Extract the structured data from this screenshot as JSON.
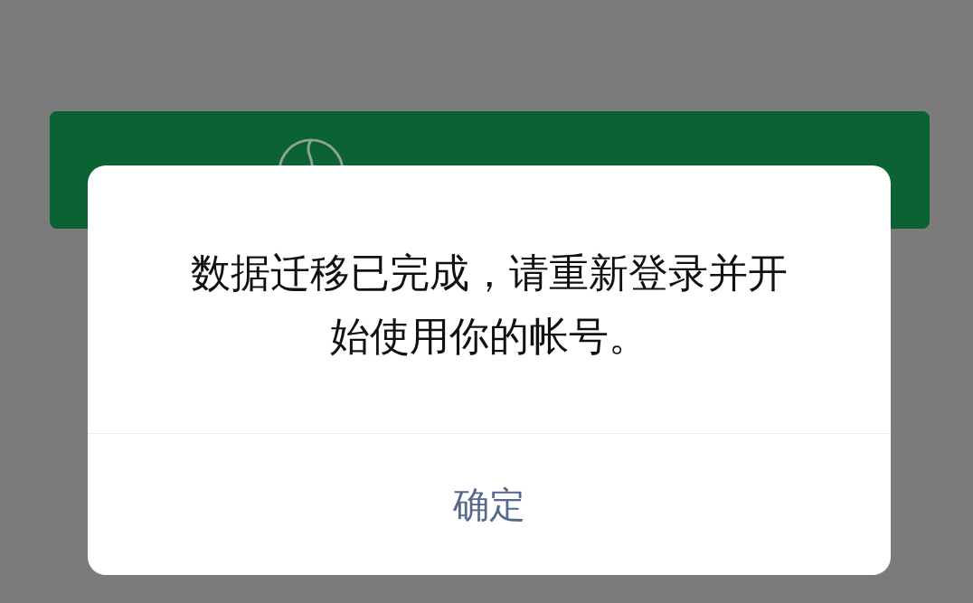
{
  "background_button": {
    "kind": "voice_lock_login"
  },
  "dialog": {
    "message": "数据迁移已完成，请重新登录并开始使用你的帐号。",
    "buttons": [
      {
        "label": "确定"
      }
    ]
  }
}
